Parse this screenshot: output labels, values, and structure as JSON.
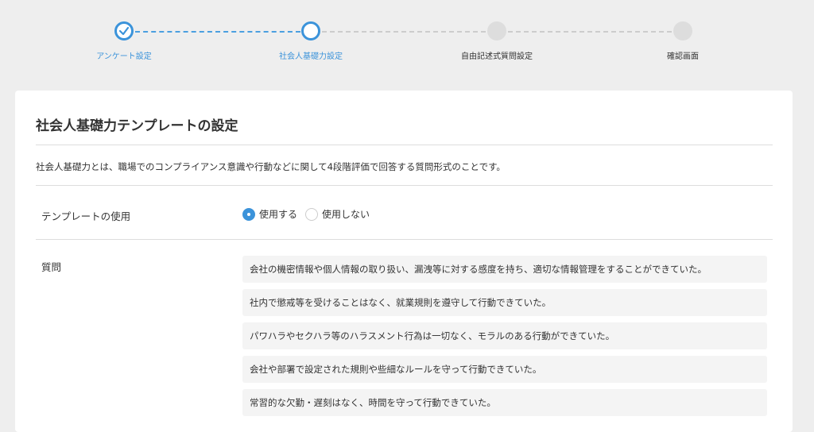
{
  "stepper": {
    "steps": [
      {
        "label": "アンケート設定",
        "state": "done"
      },
      {
        "label": "社会人基礎力設定",
        "state": "current"
      },
      {
        "label": "自由記述式質問設定",
        "state": "pending"
      },
      {
        "label": "確認画面",
        "state": "pending"
      }
    ],
    "accent": "#3b93da"
  },
  "card": {
    "title": "社会人基礎力テンプレートの設定",
    "description": "社会人基礎力とは、職場でのコンプライアンス意識や行動などに関して4段階評価で回答する質問形式のことです。",
    "template_usage": {
      "label": "テンプレートの使用",
      "options": [
        "使用する",
        "使用しない"
      ],
      "selected": "使用する"
    },
    "questions": {
      "label": "質問",
      "items": [
        "会社の機密情報や個人情報の取り扱い、漏洩等に対する感度を持ち、適切な情報管理をすることができていた。",
        "社内で懲戒等を受けることはなく、就業規則を遵守して行動できていた。",
        "パワハラやセクハラ等のハラスメント行為は一切なく、モラルのある行動ができていた。",
        "会社や部署で設定された規則や些細なルールを守って行動できていた。",
        "常習的な欠勤・遅刻はなく、時間を守って行動できていた。"
      ]
    }
  }
}
